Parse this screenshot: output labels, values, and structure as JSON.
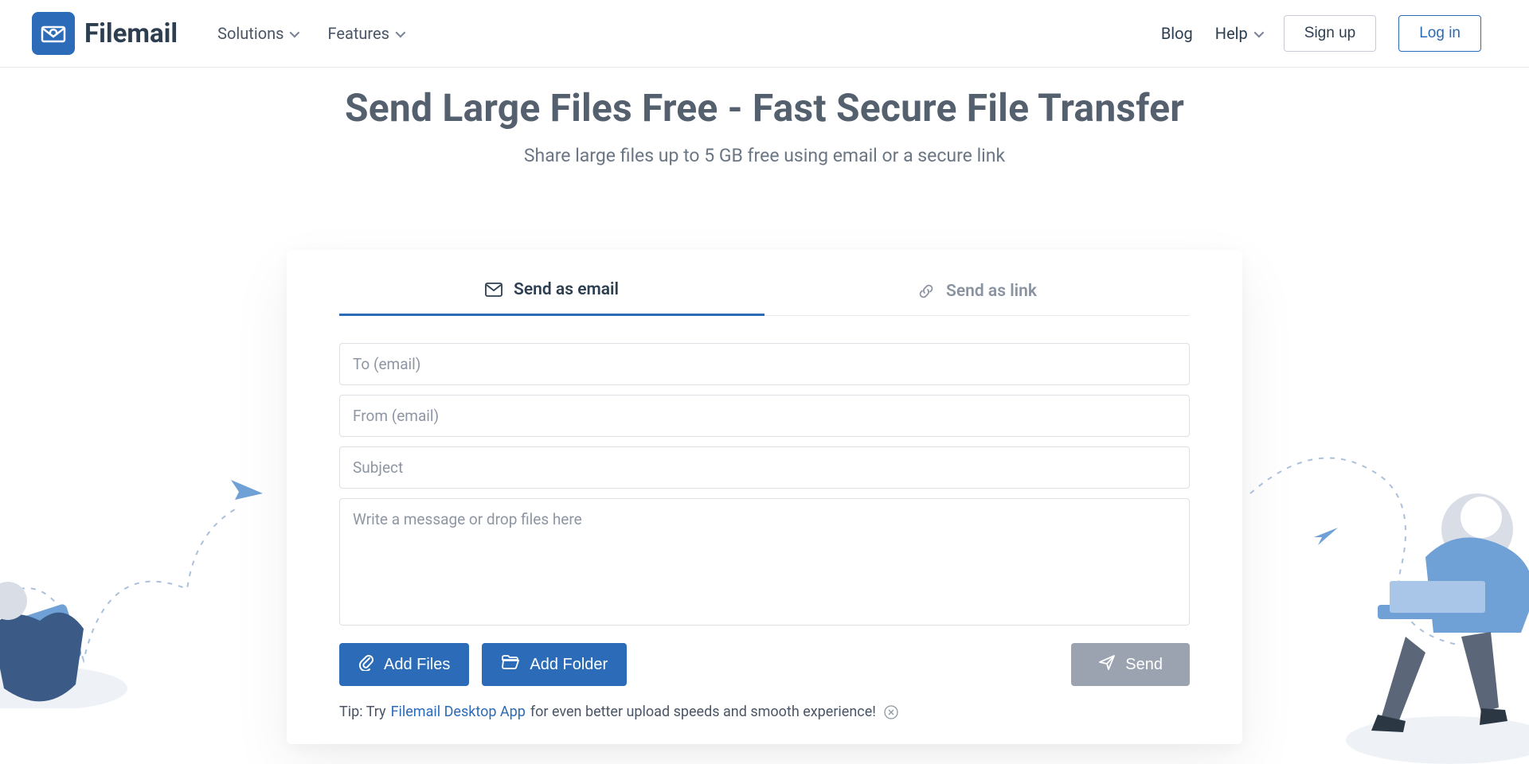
{
  "brand": {
    "name": "Filemail"
  },
  "nav": {
    "solutions": "Solutions",
    "features": "Features"
  },
  "header": {
    "blog": "Blog",
    "help": "Help",
    "signup": "Sign up",
    "login": "Log in"
  },
  "hero": {
    "title": "Send Large Files Free - Fast Secure File Transfer",
    "subtitle": "Share large files up to 5 GB free using email or a secure link"
  },
  "tabs": {
    "email": "Send as email",
    "link": "Send as link"
  },
  "form": {
    "to_placeholder": "To (email)",
    "from_placeholder": "From (email)",
    "subject_placeholder": "Subject",
    "message_placeholder": "Write a message or drop files here"
  },
  "buttons": {
    "add_files": "Add Files",
    "add_folder": "Add Folder",
    "send": "Send"
  },
  "tip": {
    "prefix": "Tip: Try ",
    "link_text": "Filemail Desktop App",
    "suffix": " for even better upload speeds and smooth experience!"
  },
  "colors": {
    "brand_blue": "#2b6bb8",
    "text_dark": "#2c3e50",
    "text_muted": "#6b7684",
    "disabled": "#9aa3af"
  }
}
